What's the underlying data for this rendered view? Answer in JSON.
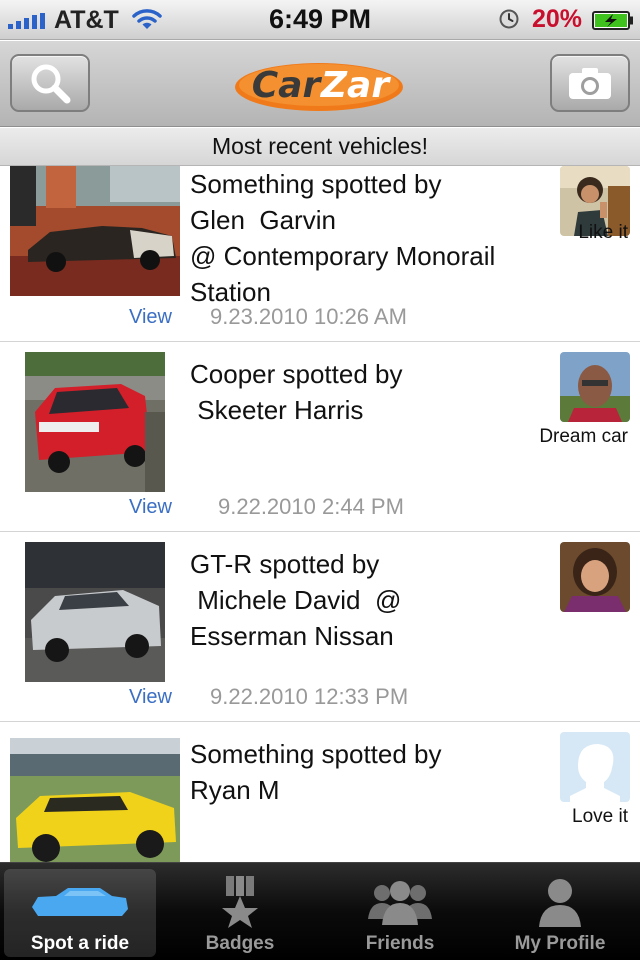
{
  "status_bar": {
    "carrier": "AT&T",
    "time": "6:49 PM",
    "battery_percent": "20%",
    "battery_level": 0.2,
    "signal_icon": "signal-bars-icon",
    "wifi_icon": "wifi-icon",
    "alarm_icon": "alarm-clock-icon",
    "battery_icon": "battery-charging-icon"
  },
  "nav_bar": {
    "left_icon": "search-icon",
    "logo_text_part1": "Car",
    "logo_text_part2": "Zar",
    "right_icon": "camera-icon"
  },
  "banner": {
    "text": "Most recent vehicles!"
  },
  "feed": {
    "items": [
      {
        "text": "Something spotted by\nGlen  Garvin\n@ Contemporary Monorail\nStation",
        "view_label": "View",
        "timestamp": "9.23.2010 10:26 AM",
        "reaction": "Like it"
      },
      {
        "text": "Cooper spotted by\n Skeeter Harris",
        "view_label": "View",
        "timestamp": "9.22.2010 2:44 PM",
        "reaction": "Dream car"
      },
      {
        "text": "GT-R spotted by\n Michele David  @\nEsserman Nissan",
        "view_label": "View",
        "timestamp": "9.22.2010 12:33 PM",
        "reaction": ""
      },
      {
        "text": "Something spotted by\nRyan M",
        "view_label": "",
        "timestamp": "",
        "reaction": "Love it"
      }
    ]
  },
  "tab_bar": {
    "tabs": [
      {
        "label": "Spot a ride",
        "icon": "car-icon",
        "selected": true
      },
      {
        "label": "Badges",
        "icon": "badge-icon",
        "selected": false
      },
      {
        "label": "Friends",
        "icon": "friends-icon",
        "selected": false
      },
      {
        "label": "My Profile",
        "icon": "profile-icon",
        "selected": false
      }
    ]
  },
  "colors": {
    "brand_orange": "#f07a1a",
    "link_blue": "#3b6fc4",
    "battery_red": "#c8102e",
    "battery_green": "#3fc21d",
    "selected_tab_blue": "#4aa8f0"
  }
}
